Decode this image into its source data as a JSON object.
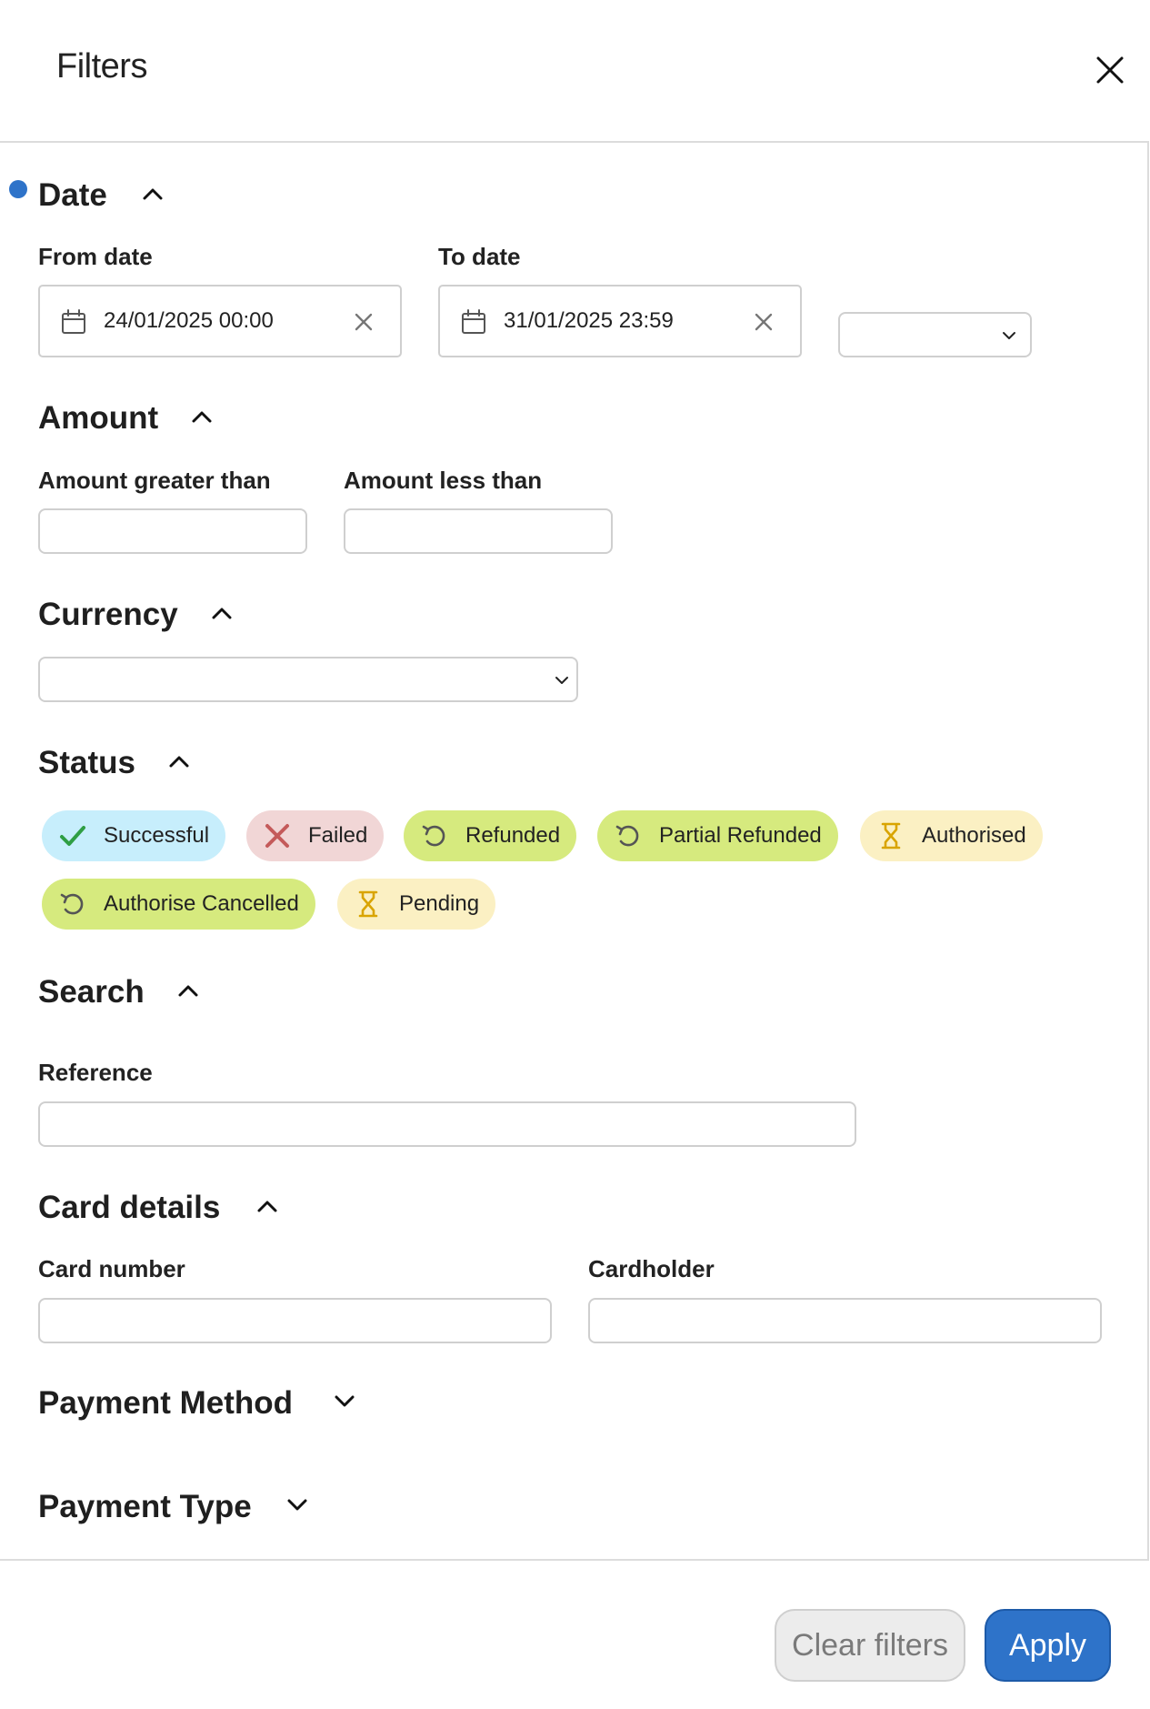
{
  "header": {
    "title": "Filters"
  },
  "date": {
    "title": "Date",
    "active_indicator_color": "#2e73c9",
    "from_label": "From date",
    "from_value": "24/01/2025 00:00",
    "to_label": "To date",
    "to_value": "31/01/2025 23:59",
    "timezone_value": ""
  },
  "amount": {
    "title": "Amount",
    "greater_label": "Amount greater than",
    "greater_value": "",
    "less_label": "Amount less than",
    "less_value": ""
  },
  "currency": {
    "title": "Currency",
    "value": ""
  },
  "status": {
    "title": "Status",
    "chips": [
      {
        "label": "Successful",
        "icon": "check-icon",
        "color": "#c7eefc"
      },
      {
        "label": "Failed",
        "icon": "x-icon",
        "color": "#f1d6d6"
      },
      {
        "label": "Refunded",
        "icon": "refund-icon",
        "color": "#d6ea7e"
      },
      {
        "label": "Partial Refunded",
        "icon": "refund-icon",
        "color": "#d6ea7e"
      },
      {
        "label": "Authorised",
        "icon": "hourglass-icon",
        "color": "#fbf0c3"
      },
      {
        "label": "Authorise Cancelled",
        "icon": "refund-icon",
        "color": "#d6ea7e"
      },
      {
        "label": "Pending",
        "icon": "hourglass-icon",
        "color": "#fbf0c3"
      }
    ]
  },
  "search": {
    "title": "Search",
    "reference_label": "Reference",
    "reference_value": ""
  },
  "card": {
    "title": "Card details",
    "number_label": "Card number",
    "number_value": "",
    "holder_label": "Cardholder",
    "holder_value": ""
  },
  "payment_method": {
    "title": "Payment Method"
  },
  "payment_type": {
    "title": "Payment Type"
  },
  "footer": {
    "clear_label": "Clear filters",
    "apply_label": "Apply"
  },
  "colors": {
    "accent": "#2e73c9",
    "success_icon": "#2f9e44",
    "failed_icon": "#c45a5a",
    "pending_icon": "#d9a400"
  }
}
